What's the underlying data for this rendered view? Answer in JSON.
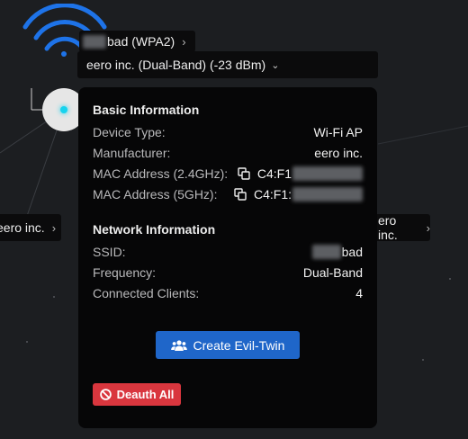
{
  "graph": {
    "ssid_suffix": "bad (WPA2)",
    "selected_device": "eero inc. (Dual-Band) (-23 dBm)",
    "left_node_label": "eero inc.",
    "right_node_label": "ero inc."
  },
  "panel": {
    "basic_title": "Basic Information",
    "device_type_label": "Device Type:",
    "device_type_value": "Wi-Fi AP",
    "manufacturer_label": "Manufacturer:",
    "manufacturer_value": "eero inc.",
    "mac24_label": "MAC Address (2.4GHz):",
    "mac24_value": "C4:F1",
    "mac5_label": "MAC Address (5GHz):",
    "mac5_value": "C4:F1:",
    "network_title": "Network Information",
    "ssid_label": "SSID:",
    "ssid_value": "bad",
    "frequency_label": "Frequency:",
    "frequency_value": "Dual-Band",
    "clients_label": "Connected Clients:",
    "clients_value": "4",
    "evil_twin_label": "Create Evil-Twin",
    "deauth_label": "Deauth All"
  },
  "colors": {
    "background": "#1c1e21",
    "panel": "#060607",
    "primary_button": "#1f66c9",
    "danger_button": "#d9363e",
    "ap_dot": "#16d3ee",
    "wifi_arcs": "#1e73e8"
  },
  "icons": [
    "wifi-icon",
    "chevron-right-icon",
    "chevron-down-icon",
    "copy-icon",
    "users-icon",
    "ban-icon"
  ]
}
